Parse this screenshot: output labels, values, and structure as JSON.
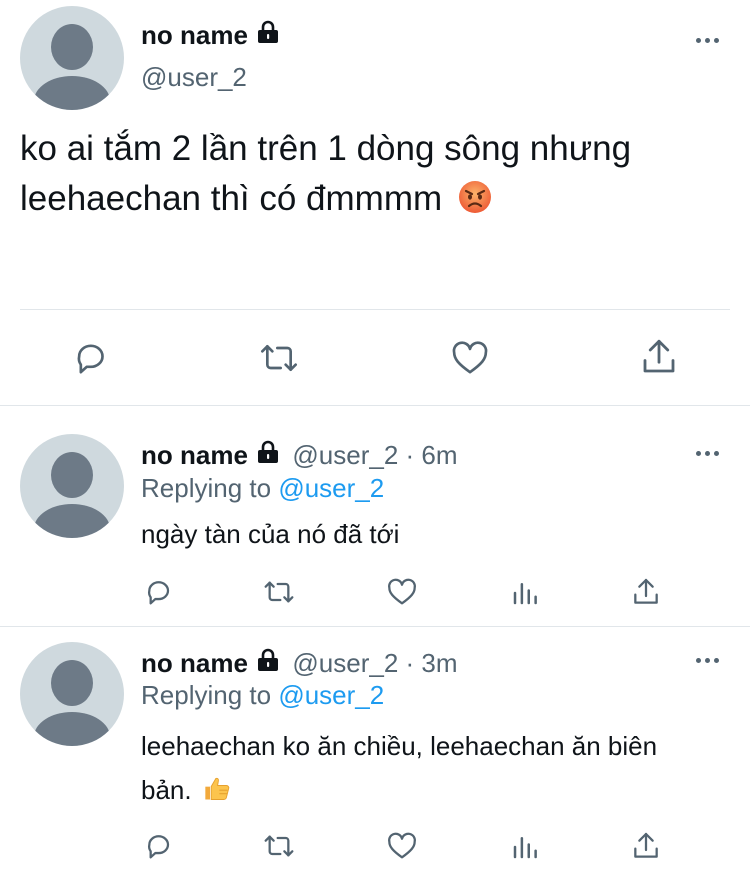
{
  "main_tweet": {
    "name": "no name",
    "handle": "@user_2",
    "text_line1": "ko ai tắm 2 lần trên 1 dòng sông nhưng",
    "text_line2": "leehaechan thì có đmmmm",
    "emoji": "angry-face-emoji"
  },
  "replies": [
    {
      "name": "no name",
      "meta": "@user_2 · 6m",
      "replying_prefix": "Replying to",
      "replying_handle": "@user_2",
      "text_line1": "ngày tàn của nó đã tới",
      "text_line2": ""
    },
    {
      "name": "no name",
      "meta": "@user_2 · 3m",
      "replying_prefix": "Replying to",
      "replying_handle": "@user_2",
      "text_line1": "leehaechan ko ăn chiều, leehaechan ăn biên",
      "text_line2": "bản.",
      "emoji": "thumbs-up-emoji"
    }
  ],
  "colors": {
    "text": "#0f1419",
    "muted": "#536471",
    "link": "#1d9bf0",
    "avatar_bg": "#cfd9de",
    "avatar_fg": "#6d7a87",
    "divider": "#e1e6ea"
  }
}
